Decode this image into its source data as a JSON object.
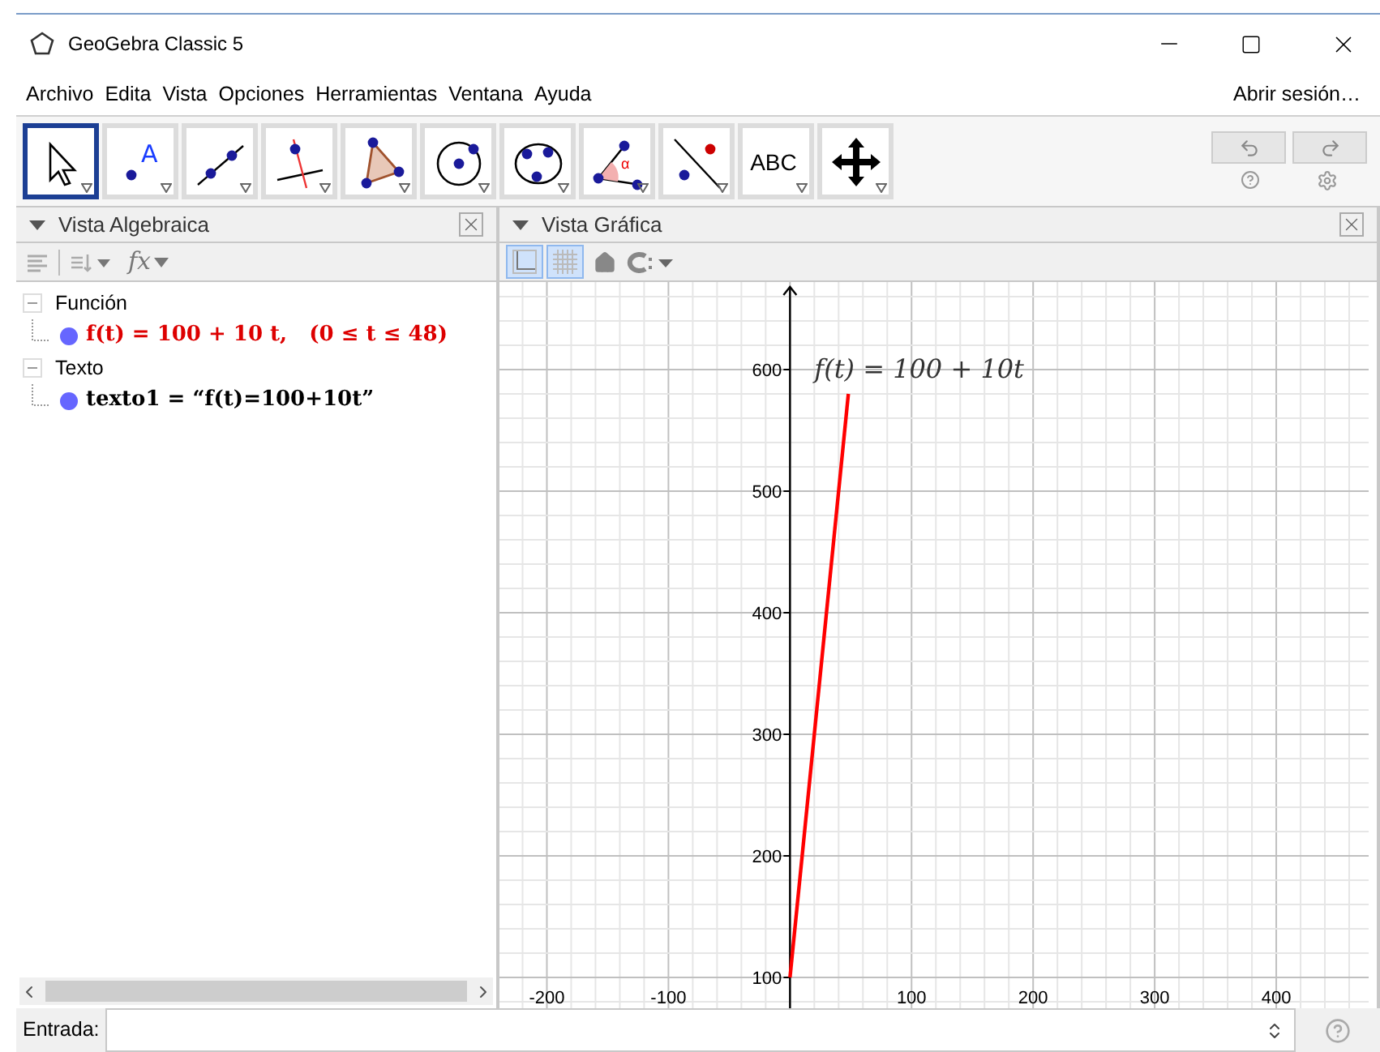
{
  "window": {
    "title": "GeoGebra Classic 5"
  },
  "menu": [
    "Archivo",
    "Edita",
    "Vista",
    "Opciones",
    "Herramientas",
    "Ventana",
    "Ayuda"
  ],
  "login": "Abrir sesión…",
  "tools": [
    {
      "kind": "move",
      "selected": true
    },
    {
      "kind": "point",
      "label": "A",
      "selected": false
    },
    {
      "kind": "line",
      "selected": false
    },
    {
      "kind": "perpendicular",
      "selected": false
    },
    {
      "kind": "polygon",
      "selected": false
    },
    {
      "kind": "circle",
      "selected": false
    },
    {
      "kind": "conic",
      "selected": false
    },
    {
      "kind": "angle",
      "label": "α",
      "selected": false
    },
    {
      "kind": "reflect",
      "selected": false
    },
    {
      "kind": "text",
      "label": "ABC",
      "selected": false
    },
    {
      "kind": "pan",
      "selected": false
    }
  ],
  "algebra_view": {
    "title": "Vista Algebraica",
    "fx": "fx",
    "groups": [
      {
        "name": "Función",
        "expanded": true,
        "items": [
          {
            "text": "f(t) = 100 + 10 t,   (0 ≤ t ≤ 48)",
            "color": "#dd0000"
          }
        ]
      },
      {
        "name": "Texto",
        "expanded": true,
        "items": [
          {
            "text": "texto1 = “f(t)=100+10t”",
            "color": "#000000"
          }
        ]
      }
    ]
  },
  "graphics_view": {
    "title": "Vista Gráfica",
    "axes_on": true,
    "grid_on": true,
    "chart_data": {
      "type": "line",
      "grid": true,
      "x": [
        0,
        48
      ],
      "series": [
        {
          "name": "f(t) = 100 + 10t",
          "color": "#ff0000",
          "values": [
            100,
            580
          ]
        }
      ],
      "xlim": [
        -239,
        476
      ],
      "ylim": [
        72,
        672
      ],
      "xticks": [
        -200,
        -100,
        100,
        200,
        300,
        400
      ],
      "yticks": [
        100,
        200,
        300,
        400,
        500,
        600
      ]
    }
  },
  "input_bar": {
    "label": "Entrada:"
  }
}
